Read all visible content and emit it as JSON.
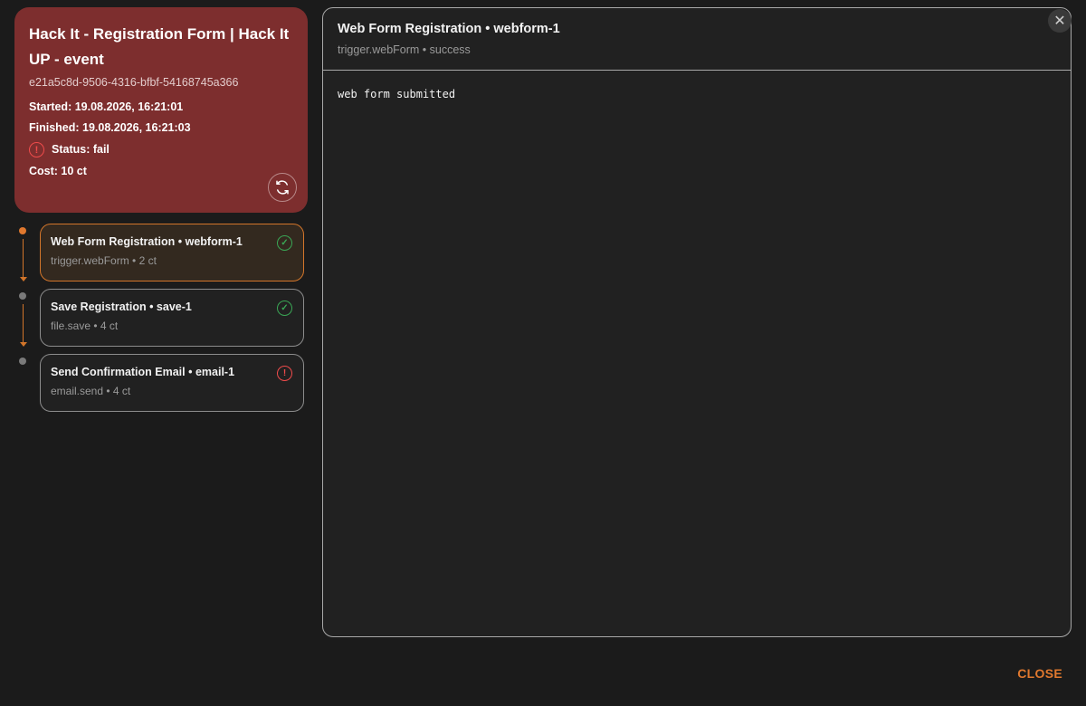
{
  "run": {
    "title": "Hack It - Registration Form | Hack It UP - event",
    "id": "e21a5c8d-9506-4316-bfbf-54168745a366",
    "started": "Started: 19.08.2026, 16:21:01",
    "finished": "Finished: 19.08.2026, 16:21:03",
    "status": "Status: fail",
    "cost": "Cost: 10 ct",
    "status_icon": "!",
    "refresh_icon": "refresh-icon"
  },
  "steps": [
    {
      "title": "Web Form Registration • webform-1",
      "sub": "trigger.webForm • 2 ct",
      "status": "success",
      "icon": "✓"
    },
    {
      "title": "Save Registration • save-1",
      "sub": "file.save • 4 ct",
      "status": "success",
      "icon": "✓"
    },
    {
      "title": "Send Confirmation Email • email-1",
      "sub": "email.send • 4 ct",
      "status": "fail",
      "icon": "!"
    }
  ],
  "detail": {
    "title": "Web Form Registration • webform-1",
    "sub": "trigger.webForm • success",
    "output": "web form submitted"
  },
  "close_icon": "✕",
  "close_label": "CLOSE",
  "colors": {
    "accent": "#e0782e",
    "fail_card": "#7d2e2e",
    "success": "#3aa655",
    "error": "#ef4b4b"
  }
}
